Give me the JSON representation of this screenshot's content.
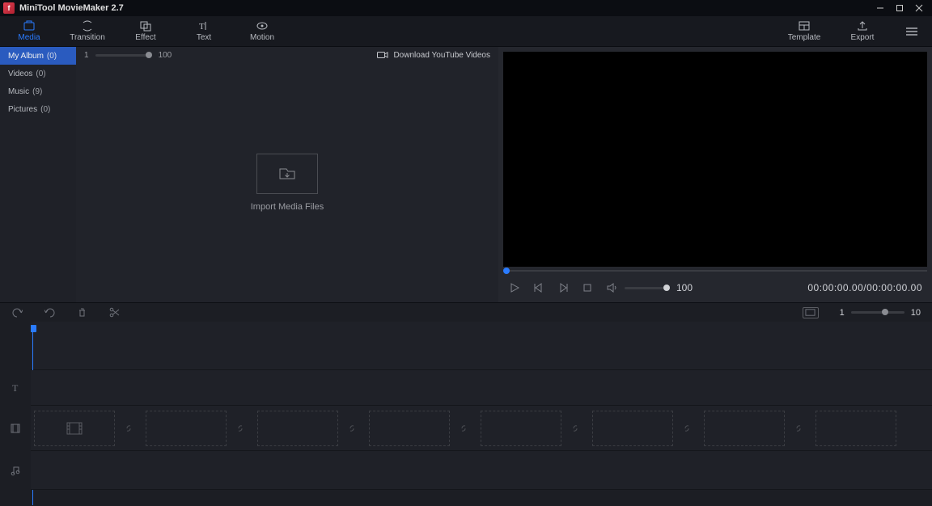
{
  "app": {
    "title": "MiniTool MovieMaker 2.7"
  },
  "toolbar": {
    "items": [
      {
        "label": "Media"
      },
      {
        "label": "Transition"
      },
      {
        "label": "Effect"
      },
      {
        "label": "Text"
      },
      {
        "label": "Motion"
      }
    ],
    "right": [
      {
        "label": "Template"
      },
      {
        "label": "Export"
      }
    ]
  },
  "sidebar": {
    "items": [
      {
        "label": "My Album",
        "count": "(0)"
      },
      {
        "label": "Videos",
        "count": "(0)"
      },
      {
        "label": "Music",
        "count": "(9)"
      },
      {
        "label": "Pictures",
        "count": "(0)"
      }
    ]
  },
  "media": {
    "thumbMin": "1",
    "thumbMax": "100",
    "ytLabel": "Download YouTube Videos",
    "importLabel": "Import Media Files"
  },
  "preview": {
    "volume": "100",
    "timecode": "00:00:00.00/00:00:00.00"
  },
  "timeline": {
    "zoomMin": "1",
    "zoomMax": "10"
  }
}
